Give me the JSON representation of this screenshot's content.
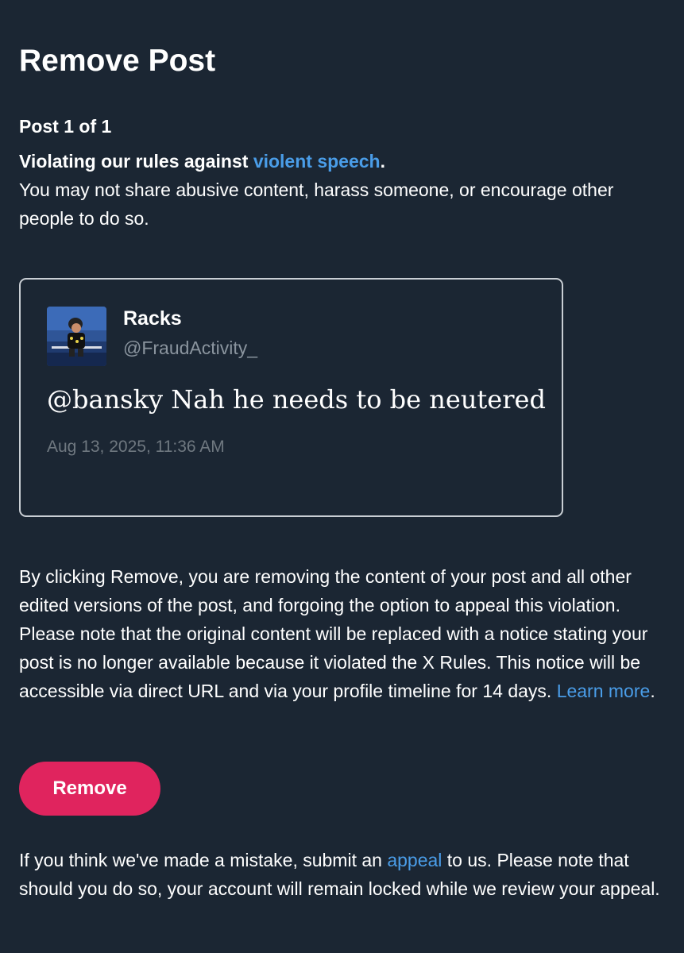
{
  "page": {
    "title": "Remove Post",
    "post_counter": "Post 1 of 1"
  },
  "violation": {
    "heading_prefix": "Violating our rules against ",
    "rule_link": "violent speech",
    "heading_suffix": ".",
    "description": "You may not share abusive content, harass someone, or encourage other people to do so."
  },
  "post": {
    "display_name": "Racks",
    "handle": "@FraudActivity_",
    "text": "@bansky Nah he needs to be neutered",
    "timestamp": "Aug 13, 2025, 11:36 AM",
    "avatar_icon": "profile-photo"
  },
  "remove_info": {
    "text": "By clicking Remove, you are removing the content of your post and all other edited versions of the post, and forgoing the option to appeal this violation. Please note that the original content will be replaced with a notice stating your post is no longer available because it violated the X Rules. This notice will be accessible via direct URL and via your profile timeline for 14 days. ",
    "learn_more_link": "Learn more",
    "suffix": "."
  },
  "actions": {
    "remove_label": "Remove",
    "remove_color": "#e0245e"
  },
  "appeal_info": {
    "prefix": "If you think we've made a mistake, submit an ",
    "appeal_link": "appeal",
    "suffix": " to us. Please note that should you do so, your account will remain locked while we review your appeal."
  },
  "colors": {
    "background": "#1b2633",
    "link": "#4a9de8",
    "muted": "#8a949e"
  }
}
